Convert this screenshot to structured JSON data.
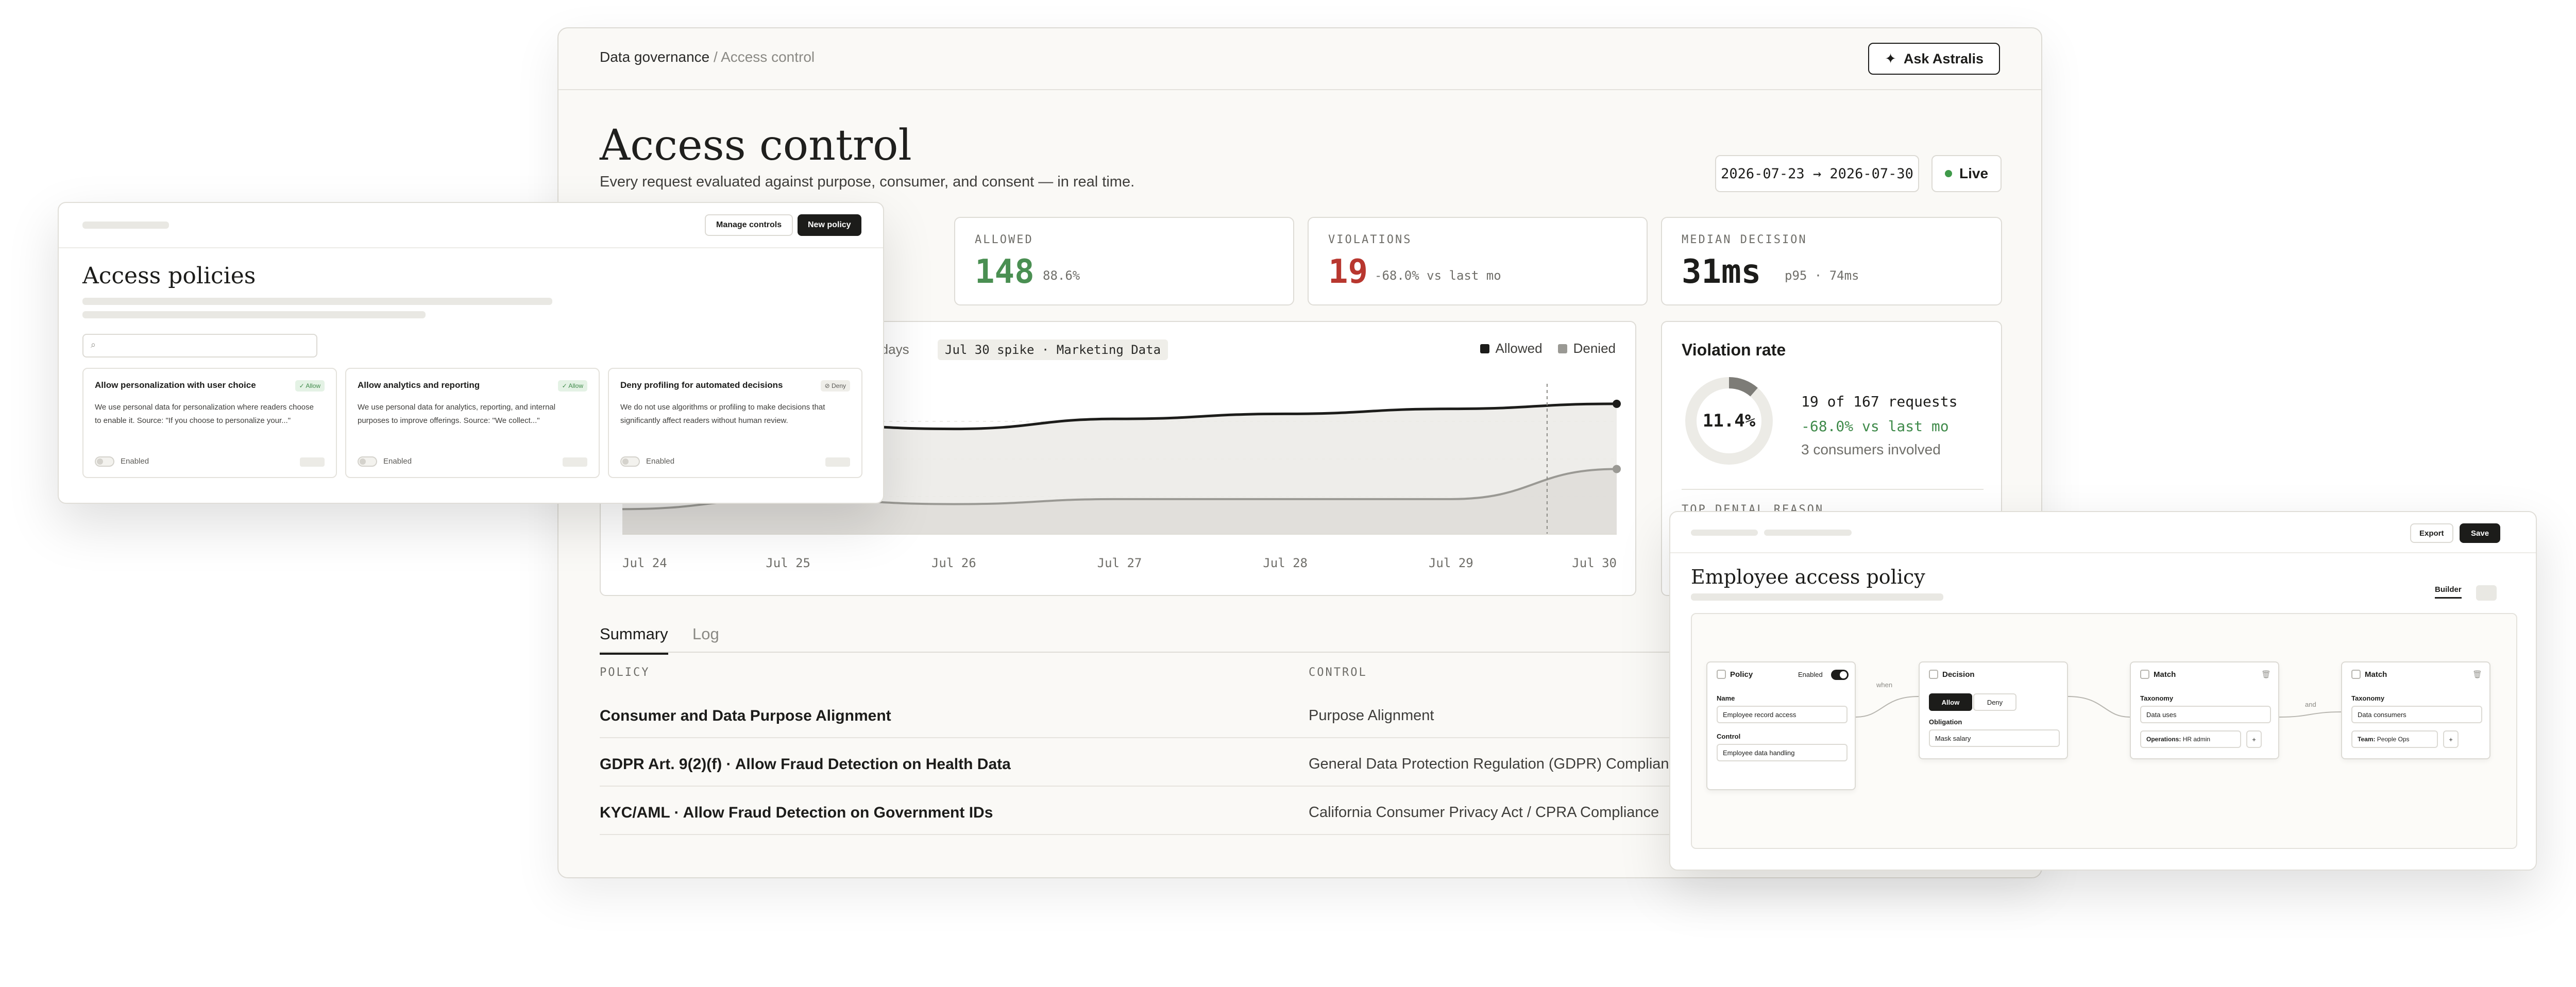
{
  "main": {
    "breadcrumb": {
      "parent": "Data governance",
      "separator": "/",
      "current": "Access control"
    },
    "ask_button": {
      "icon": "sparkle-icon",
      "label": "Ask Astralis"
    },
    "title": "Access control",
    "subtitle": "Every request evaluated against purpose, consumer, and consent — in real time.",
    "date_range": "2026-07-23 → 2026-07-30",
    "live_label": "Live",
    "kpis": {
      "allowed": {
        "label": "ALLOWED",
        "value": "148",
        "sub": "88.6%",
        "color": "#4a8f52"
      },
      "violations": {
        "label": "VIOLATIONS",
        "value": "19",
        "sub": "-68.0% vs last mo",
        "color": "#b8372f"
      },
      "median": {
        "label": "MEDIAN DECISION",
        "value": "31ms",
        "sub": "p95 · 74ms",
        "color": "#1c1c1a"
      }
    },
    "chart": {
      "range_label": "7 days",
      "annotation": "Jul 30 spike · Marketing Data"
    },
    "violation_rate": {
      "title": "Violation rate",
      "percent_label": "11.4%",
      "line1": "19 of 167 requests",
      "line2": "-68.0% vs last mo",
      "line3": "3 consumers involved",
      "top_denial_label": "TOP DENIAL REASON"
    },
    "tabs": [
      {
        "label": "Summary",
        "active": true
      },
      {
        "label": "Log",
        "active": false
      }
    ],
    "table": {
      "headers": {
        "policy": "POLICY",
        "control": "CONTROL"
      },
      "rows": [
        {
          "policy": "Consumer and Data Purpose Alignment",
          "control": "Purpose Alignment"
        },
        {
          "policy": "GDPR Art. 9(2)(f) · Allow Fraud Detection on Health Data",
          "control": "General Data Protection Regulation (GDPR) Compliance"
        },
        {
          "policy": "KYC/AML · Allow Fraud Detection on Government IDs",
          "control": "California Consumer Privacy Act / CPRA Compliance"
        }
      ]
    }
  },
  "chart_data": {
    "type": "area",
    "x": [
      "Jul 24",
      "Jul 25",
      "Jul 26",
      "Jul 27",
      "Jul 28",
      "Jul 29",
      "Jul 30"
    ],
    "series": [
      {
        "name": "Allowed",
        "color": "#1c1c1a",
        "values": [
          18,
          22,
          21,
          23,
          24,
          25,
          26
        ]
      },
      {
        "name": "Denied",
        "color": "#9a9994",
        "values": [
          5,
          7,
          6,
          7,
          7,
          7,
          13
        ]
      }
    ],
    "ylim": [
      0,
      30
    ],
    "annotation_x": "Jul 29",
    "grid": true,
    "legend": "top-right"
  },
  "left_window": {
    "manage_button": "Manage controls",
    "new_button": "New policy",
    "title": "Access policies",
    "search_icon": "search-icon",
    "cards": [
      {
        "title": "Allow personalization with user choice",
        "badge": "✓ Allow",
        "badge_type": "allow",
        "description": "We use personal data for personalization where readers choose to enable it. Source: \"If you choose to personalize your...\"",
        "status": "Enabled"
      },
      {
        "title": "Allow analytics and reporting",
        "badge": "✓ Allow",
        "badge_type": "allow",
        "description": "We use personal data for analytics, reporting, and internal purposes to improve offerings. Source: \"We collect...\"",
        "status": "Enabled"
      },
      {
        "title": "Deny profiling for automated decisions",
        "badge": "⊘ Deny",
        "badge_type": "deny",
        "description": "We do not use algorithms or profiling to make decisions that significantly affect readers without human review.",
        "status": "Enabled"
      }
    ]
  },
  "right_window": {
    "export_button": "Export",
    "save_button": "Save",
    "title": "Employee access policy",
    "builder_tab": "Builder",
    "nodes": {
      "policy": {
        "title": "Policy",
        "enabled_label": "Enabled",
        "name_label": "Name",
        "name_value": "Employee record access",
        "control_label": "Control",
        "control_value": "Employee data handling"
      },
      "decision": {
        "title": "Decision",
        "allow": "Allow",
        "deny": "Deny",
        "obligation_label": "Obligation",
        "obligation_value": "Mask salary"
      },
      "match1": {
        "title": "Match",
        "taxonomy_label": "Taxonomy",
        "taxonomy_value": "Data uses",
        "chip_key": "Operations:",
        "chip_value": "HR admin"
      },
      "match2": {
        "title": "Match",
        "taxonomy_label": "Taxonomy",
        "taxonomy_value": "Data consumers",
        "chip_key": "Team:",
        "chip_value": "People Ops"
      }
    },
    "edges": {
      "when": "when",
      "and": "and"
    }
  }
}
